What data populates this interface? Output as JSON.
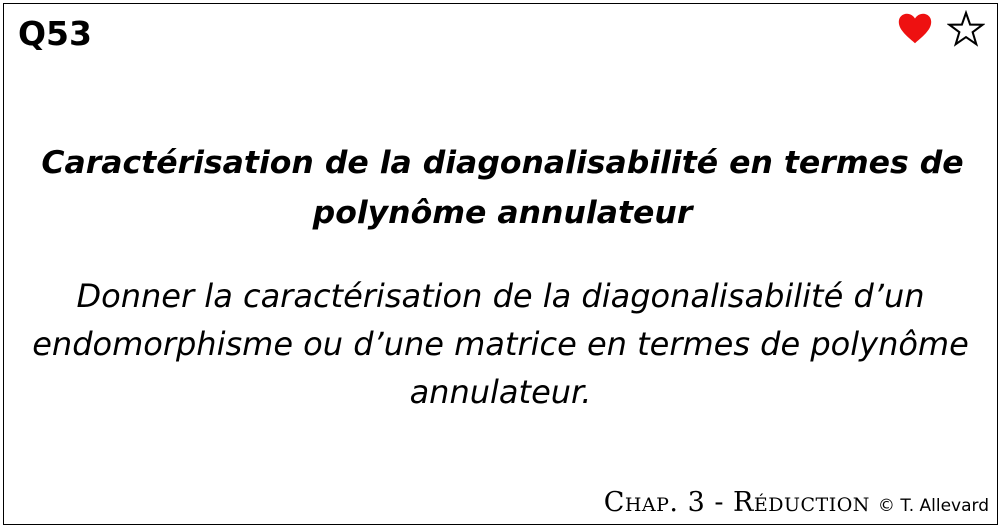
{
  "card": {
    "number": "Q53",
    "title": "Caractérisation de la diagonalisabilité en termes de polynôme annulateur",
    "prompt": "Donner la caractérisation de la diagonalisabilité d’un endomorphisme ou d’une matrice en termes de polynôme annulateur.",
    "chapter": "Chap. 3 - Réduction",
    "author": "© T. Allevard"
  },
  "icons": {
    "favorite": {
      "name": "heart-icon",
      "color": "#ee1111",
      "filled": true
    },
    "bookmark": {
      "name": "star-icon",
      "color": "#000000",
      "filled": false
    }
  }
}
